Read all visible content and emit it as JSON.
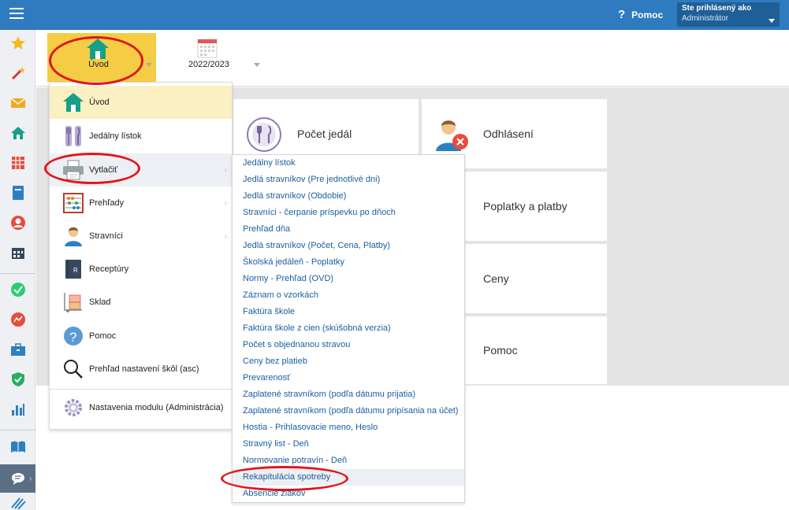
{
  "topbar": {
    "help_label": "Pomoc",
    "help_icon": "question-mark-icon",
    "user_caption": "Ste prihlásený ako",
    "user_role": "Administrátor"
  },
  "header": {
    "home_label": "Úvod",
    "year_label": "2022/2023"
  },
  "menu": {
    "items": [
      {
        "label": "Úvod",
        "icon": "house-icon"
      },
      {
        "label": "Jedálny lístok",
        "icon": "cutlery-icon"
      },
      {
        "label": "Vytlačiť",
        "icon": "printer-icon"
      },
      {
        "label": "Prehľady",
        "icon": "abacus-icon"
      },
      {
        "label": "Stravníci",
        "icon": "person-icon"
      },
      {
        "label": "Receptúry",
        "icon": "recipe-book-icon"
      },
      {
        "label": "Sklad",
        "icon": "boxes-cart-icon"
      },
      {
        "label": "Pomoc",
        "icon": "help-icon"
      },
      {
        "label": "Prehľad nastavení škôl (asc)",
        "icon": "magnifier-icon"
      },
      {
        "label": "Nastavenia modulu (Administrácia)",
        "icon": "gear-icon"
      }
    ]
  },
  "submenu": {
    "items": [
      "Jedálny lístok",
      "Jedlá stravníkov (Pre jednotlivé dni)",
      "Jedlá stravníkov (Obdobie)",
      "Stravníci - čerpanie príspevku po dňoch",
      "Prehľad dňa",
      "Jedlá stravníkov (Počet, Cena, Platby)",
      "Školská jedáleň - Poplatky",
      "Normy - Prehľad (OVD)",
      "Záznam o vzorkách",
      "Faktúra škole",
      "Faktúra škole z cien (skúšobná verzia)",
      "Počet s objednanou stravou",
      "Ceny bez platieb",
      "Prevarenosť",
      "Zaplatené stravníkom (podľa dátumu prijatia)",
      "Zaplatené stravníkom (podľa dátumu pripísania na účet)",
      "Hostia - Prihlasovacie meno, Heslo",
      "Stravný list - Deň",
      "Normovanie potravín - Deň",
      "Rekapitulácia spotreby",
      "Absencie žiakov"
    ]
  },
  "tiles": {
    "pocet_jedal": "Počet jedál",
    "odhlasenie": "Odhlásení",
    "poplatky": "Poplatky a platby",
    "ceny": "Ceny",
    "pomoc": "Pomoc"
  },
  "colors": {
    "topbar": "#2f7bbf",
    "accent_yellow": "#f4cd45",
    "link_blue": "#1a5e9e",
    "annotation_red": "#e2141c"
  }
}
